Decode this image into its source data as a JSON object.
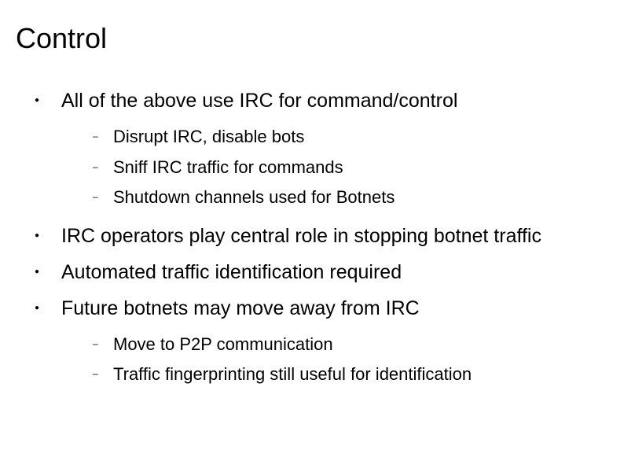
{
  "title": "Control",
  "bullets": [
    {
      "text": "All of the above use IRC for command/control",
      "sub": [
        "Disrupt IRC, disable bots",
        "Sniff IRC traffic for commands",
        "Shutdown channels used for Botnets"
      ]
    },
    {
      "text": "IRC operators play central role in stopping botnet traffic",
      "sub": []
    },
    {
      "text": "Automated traffic identification required",
      "sub": []
    },
    {
      "text": "Future botnets may move away from IRC",
      "sub": [
        "Move to P2P communication",
        "Traffic fingerprinting still useful for identification"
      ]
    }
  ]
}
